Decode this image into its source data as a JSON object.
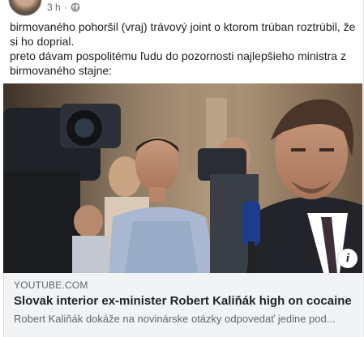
{
  "post": {
    "timestamp": "3 h",
    "privacy_icon": "globe-icon",
    "text_lines": [
      "birmovaného pohoršil (vraj) trávový joint o ktorom trúban roztrúbil, že si ho doprial.",
      "preto dávam pospolitému ľudu do pozornosti najlepšieho ministra z birmovaného stajne:"
    ]
  },
  "link_preview": {
    "domain": "YOUTUBE.COM",
    "title": "Slovak interior ex-minister Robert Kaliňák high on cocaine",
    "description": "Robert Kaliňák dokáže na novinárske otázky odpovedať jedine pod...",
    "info_icon": "info-icon",
    "info_glyph": "i"
  },
  "colors": {
    "text": "#1c1e21",
    "secondary_text": "#606770",
    "link_box_bg": "#f2f3f5",
    "page_bg": "#e9ebee"
  }
}
